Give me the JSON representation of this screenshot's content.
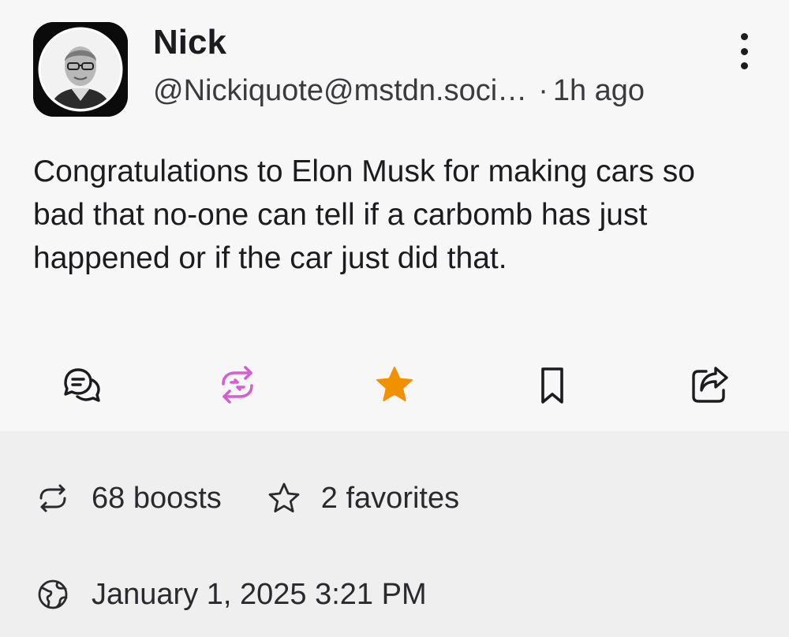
{
  "post": {
    "display_name": "Nick",
    "handle": "@Nickiquote@mstdn.soci…",
    "separator": "·",
    "time": "1h ago",
    "content": "Congratulations to Elon Musk for making cars so bad that no-one can tell if a carbomb has just happened or if the car just did that."
  },
  "actions": [
    {
      "name": "reply",
      "icon": "reply-icon",
      "color": "#1c1b1f"
    },
    {
      "name": "boost",
      "icon": "boost-icon",
      "color": "#d65fd0",
      "active": true
    },
    {
      "name": "favorite",
      "icon": "star-icon",
      "color": "#f29100",
      "active": true
    },
    {
      "name": "bookmark",
      "icon": "bookmark-icon",
      "color": "#1c1b1f"
    },
    {
      "name": "share",
      "icon": "share-icon",
      "color": "#1c1b1f"
    }
  ],
  "stats": {
    "boosts_label": "68 boosts",
    "favorites_label": "2 favorites",
    "timestamp": "January 1, 2025 3:21 PM"
  }
}
